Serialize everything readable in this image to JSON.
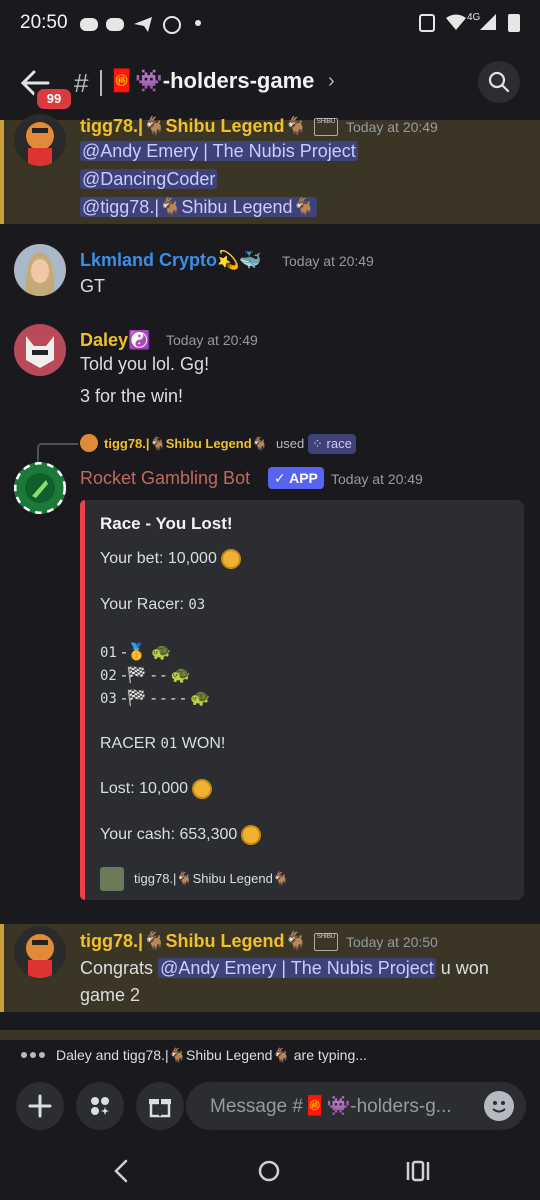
{
  "status_bar": {
    "time": "20:50",
    "network": "4G"
  },
  "header": {
    "unread_badge": "99",
    "hash": "#",
    "channel_name": "🧧👾-holders-game"
  },
  "messages": [
    {
      "author": "tigg78.|🐐Shibu Legend🐐",
      "timestamp": "Today at 20:49",
      "lines": [
        "@Andy Emery | The Nubis Project",
        "@DancingCoder",
        "@tigg78.|🐐Shibu Legend🐐"
      ]
    },
    {
      "author": "Lkmland Crypto💫🐳",
      "timestamp": "Today at 20:49",
      "lines": [
        "GT"
      ]
    },
    {
      "author": "Daley☯️",
      "timestamp": "Today at 20:49",
      "lines": [
        "Told you lol. Gg!",
        "3 for the win!"
      ]
    },
    {
      "reply_user": "tigg78.|🐐Shibu Legend🐐",
      "reply_used": "used",
      "reply_command": "race",
      "author": "Rocket Gambling Bot",
      "app_tag": "✓ APP",
      "timestamp": "Today at 20:49",
      "embed": {
        "title": "Race - You Lost!",
        "bet_label": "Your bet: 10,000",
        "racer_label": "Your Racer:",
        "racer_value": "03",
        "track": [
          {
            "num": "01",
            "sep": "-",
            "marker": "🥇",
            "dashes": "",
            "turtle": "🐢"
          },
          {
            "num": "02",
            "sep": "-",
            "marker": "🏁",
            "dashes": "- -",
            "turtle": "🐢"
          },
          {
            "num": "03",
            "sep": "-",
            "marker": "🏁",
            "dashes": "- - - -",
            "turtle": "🐢"
          }
        ],
        "winner_prefix": "RACER",
        "winner_num": "01",
        "winner_suffix": "WON!",
        "lost": "Lost: 10,000",
        "cash": "Your cash: 653,300",
        "footer_user": "tigg78.|🐐Shibu Legend🐐"
      }
    },
    {
      "author": "tigg78.|🐐Shibu Legend🐐",
      "timestamp": "Today at 20:50",
      "line1_prefix": "Congrats",
      "mention": "@Andy Emery | The Nubis Project",
      "line1_suffix": "u won",
      "line2": "game 2"
    }
  ],
  "typing": {
    "text": "Daley and tigg78.|🐐Shibu Legend🐐 are typing..."
  },
  "composer": {
    "placeholder": "Message #🧧👾-holders-g..."
  },
  "colors": {
    "background": "#1a1a1e",
    "highlight": "#3b3526",
    "mention_bg": "#3e4278",
    "gold_name": "#f0c02c",
    "blue_name": "#3b8eea",
    "bot_name": "#c1695c",
    "app_badge": "#5865f2",
    "embed_bar": "#ed4245"
  }
}
